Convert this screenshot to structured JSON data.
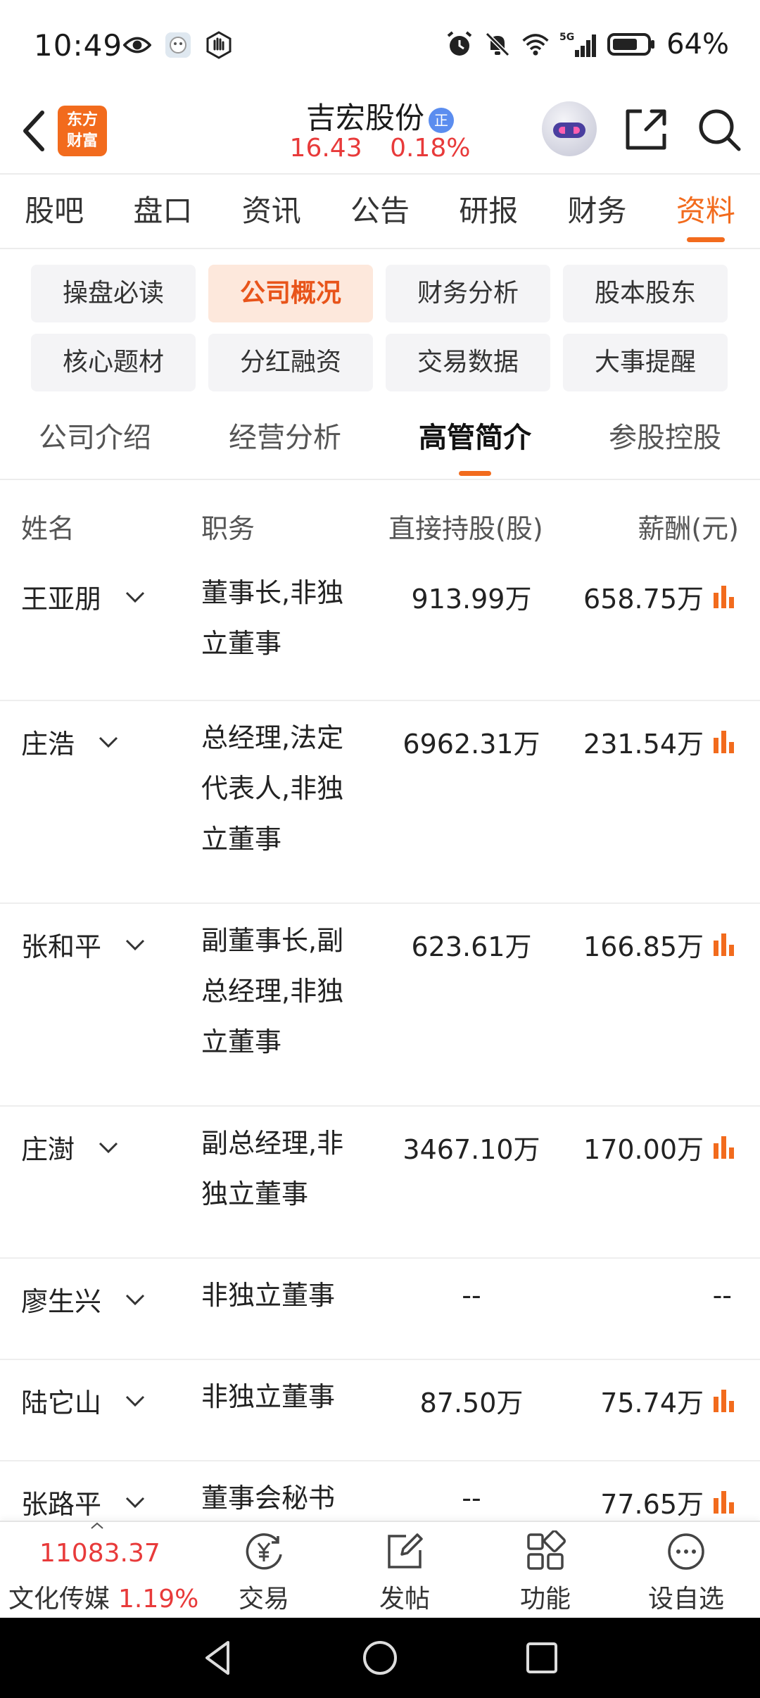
{
  "status_bar": {
    "time": "10:49",
    "network": "5G",
    "battery": "64%"
  },
  "header": {
    "app_logo_line1": "东方",
    "app_logo_line2": "财富",
    "stock_name": "吉宏股份",
    "stock_badge": "正",
    "price": "16.43",
    "change_pct": "0.18%"
  },
  "main_tabs": [
    {
      "label": "股吧",
      "active": false
    },
    {
      "label": "盘口",
      "active": false
    },
    {
      "label": "资讯",
      "active": false
    },
    {
      "label": "公告",
      "active": false
    },
    {
      "label": "研报",
      "active": false
    },
    {
      "label": "财务",
      "active": false
    },
    {
      "label": "资料",
      "active": true
    }
  ],
  "sub_buttons": [
    {
      "label": "操盘必读",
      "active": false
    },
    {
      "label": "公司概况",
      "active": true
    },
    {
      "label": "财务分析",
      "active": false
    },
    {
      "label": "股本股东",
      "active": false
    },
    {
      "label": "核心题材",
      "active": false
    },
    {
      "label": "分红融资",
      "active": false
    },
    {
      "label": "交易数据",
      "active": false
    },
    {
      "label": "大事提醒",
      "active": false
    }
  ],
  "section_tabs": [
    {
      "label": "公司介绍",
      "active": false
    },
    {
      "label": "经营分析",
      "active": false
    },
    {
      "label": "高管简介",
      "active": true
    },
    {
      "label": "参股控股",
      "active": false
    }
  ],
  "table": {
    "headers": {
      "name": "姓名",
      "role": "职务",
      "shares": "直接持股(股)",
      "salary": "薪酬(元)"
    },
    "rows": [
      {
        "name": "王亚朋",
        "role": "董事长,非独立董事",
        "shares": "913.99万",
        "salary": "658.75万",
        "has_chart": true,
        "lines": 2
      },
      {
        "name": "庄浩",
        "role": "总经理,法定代表人,非独立董事",
        "shares": "6962.31万",
        "salary": "231.54万",
        "has_chart": true,
        "lines": 3
      },
      {
        "name": "张和平",
        "role": "副董事长,副总经理,非独立董事",
        "shares": "623.61万",
        "salary": "166.85万",
        "has_chart": true,
        "lines": 3
      },
      {
        "name": "庄澍",
        "role": "副总经理,非独立董事",
        "shares": "3467.10万",
        "salary": "170.00万",
        "has_chart": true,
        "lines": 2
      },
      {
        "name": "廖生兴",
        "role": "非独立董事",
        "shares": "--",
        "salary": "--",
        "has_chart": false,
        "lines": 1
      },
      {
        "name": "陆它山",
        "role": "非独立董事",
        "shares": "87.50万",
        "salary": "75.74万",
        "has_chart": true,
        "lines": 1
      },
      {
        "name": "张路平",
        "role": "董事会秘书",
        "shares": "--",
        "salary": "77.65万",
        "has_chart": true,
        "lines": 1
      }
    ]
  },
  "bottom_bar": {
    "index_value": "11083.37",
    "index_name": "文化传媒",
    "index_change": "1.19%",
    "actions": [
      {
        "label": "交易",
        "icon": "trade-yuan-icon"
      },
      {
        "label": "发帖",
        "icon": "compose-icon"
      },
      {
        "label": "功能",
        "icon": "grid-apps-icon"
      },
      {
        "label": "设自选",
        "icon": "more-circle-icon"
      }
    ]
  },
  "colors": {
    "accent": "#f26b1d",
    "price_up": "#e83a3a",
    "active_chip_bg": "#fde8dc"
  }
}
